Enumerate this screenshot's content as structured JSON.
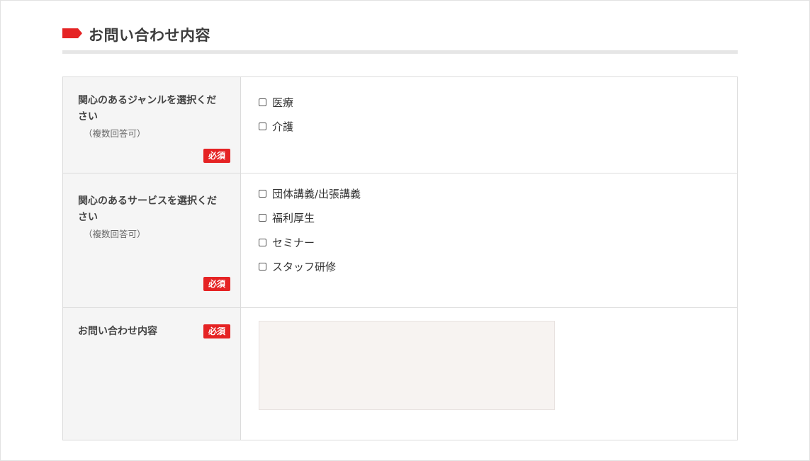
{
  "section": {
    "title": "お問い合わせ内容",
    "marker_color": "#e52324"
  },
  "form": {
    "required_label": "必須",
    "rows": [
      {
        "label": "関心のあるジャンルを選択ください",
        "note": "（複数回答可）",
        "options": [
          "医療",
          "介護"
        ]
      },
      {
        "label": "関心のあるサービスを選択ください",
        "note": "（複数回答可）",
        "options": [
          "団体講義/出張講義",
          "福利厚生",
          "セミナー",
          "スタッフ研修"
        ]
      },
      {
        "label": "お問い合わせ内容",
        "textarea_value": ""
      }
    ]
  }
}
